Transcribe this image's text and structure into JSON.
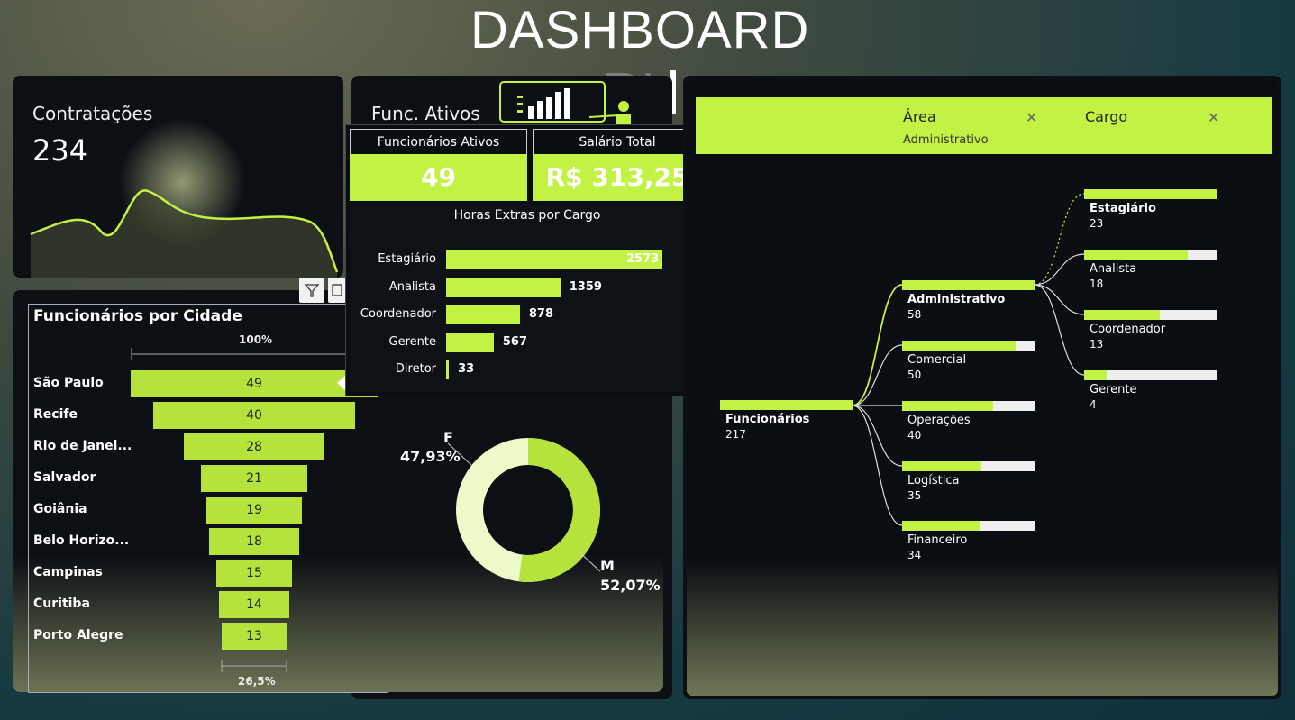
{
  "header": {
    "title": "DASHBOARD",
    "subtitle": "RH"
  },
  "contratacoes": {
    "label": "Contratações",
    "value": "234"
  },
  "func_ativos": {
    "label": "Func. Ativos"
  },
  "city": {
    "title": "Funcionários por Cidade",
    "top_pct": "100%",
    "bottom_pct": "26,5%",
    "rows": [
      {
        "name": "São Paulo",
        "value": 49
      },
      {
        "name": "Recife",
        "value": 40
      },
      {
        "name": "Rio de Janei...",
        "value": 28
      },
      {
        "name": "Salvador",
        "value": 21
      },
      {
        "name": "Goiânia",
        "value": 19
      },
      {
        "name": "Belo Horizo...",
        "value": 18
      },
      {
        "name": "Campinas",
        "value": 15
      },
      {
        "name": "Curitiba",
        "value": 14
      },
      {
        "name": "Porto Alegre",
        "value": 13
      }
    ]
  },
  "tooltip": {
    "kpi1_label": "Funcionários Ativos",
    "kpi1_value": "49",
    "kpi2_label": "Salário Total",
    "kpi2_value": "R$ 313,25 ...",
    "hx_title": "Horas Extras por Cargo",
    "hx": [
      {
        "name": "Estagiário",
        "value": 2573
      },
      {
        "name": "Analista",
        "value": 1359
      },
      {
        "name": "Coordenador",
        "value": 878
      },
      {
        "name": "Gerente",
        "value": 567
      },
      {
        "name": "Diretor",
        "value": 33
      }
    ]
  },
  "donut": {
    "f_label": "F",
    "f_pct": "47,93%",
    "m_label": "M",
    "m_pct": "52,07%"
  },
  "tree": {
    "col1_header": "Área",
    "col1_filter": "Administrativo",
    "col2_header": "Cargo",
    "root": {
      "name": "Funcionários",
      "value": "217"
    },
    "areas": [
      {
        "name": "Administrativo",
        "value": "58",
        "frac": 1.0
      },
      {
        "name": "Comercial",
        "value": "50",
        "frac": 0.86
      },
      {
        "name": "Operações",
        "value": "40",
        "frac": 0.69
      },
      {
        "name": "Logística",
        "value": "35",
        "frac": 0.6
      },
      {
        "name": "Financeiro",
        "value": "34",
        "frac": 0.59
      }
    ],
    "cargos": [
      {
        "name": "Estagiário",
        "value": "23",
        "frac": 1.0
      },
      {
        "name": "Analista",
        "value": "18",
        "frac": 0.78
      },
      {
        "name": "Coordenador",
        "value": "13",
        "frac": 0.57
      },
      {
        "name": "Gerente",
        "value": "4",
        "frac": 0.17
      }
    ]
  },
  "colors": {
    "accent": "#c2f244",
    "funnel": "#b6e33b",
    "donut_f": "#ecfbc9",
    "donut_m": "#b6e33b"
  }
}
